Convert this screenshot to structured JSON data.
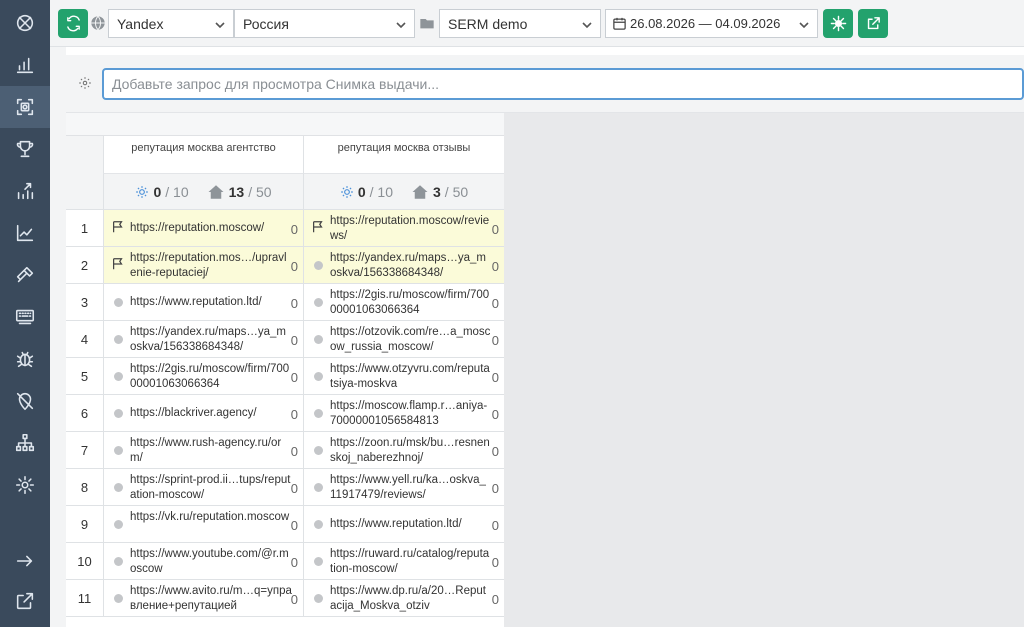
{
  "sidebar": {
    "items": [
      {
        "icon": "logo-icon"
      },
      {
        "icon": "bar-chart-icon"
      },
      {
        "icon": "camera-scan-icon",
        "active": true
      },
      {
        "icon": "trophy-icon"
      },
      {
        "icon": "chart-up-icon"
      },
      {
        "icon": "line-chart-icon"
      },
      {
        "icon": "hammer-icon"
      },
      {
        "icon": "keyboard-icon"
      },
      {
        "icon": "bug-icon"
      },
      {
        "icon": "location-off-icon"
      },
      {
        "icon": "sitemap-icon"
      },
      {
        "icon": "settings-icon"
      },
      {
        "icon": "arrow-right-icon"
      },
      {
        "icon": "external-link-icon"
      }
    ]
  },
  "toolbar": {
    "search_engine": "Yandex",
    "region": "Россия",
    "project": "SERM demo",
    "date_range": "26.08.2026 — 04.09.2026",
    "accent_color": "#23a26d"
  },
  "query": {
    "placeholder": "Добавьте запрос для просмотра Снимка выдачи..."
  },
  "columns": [
    {
      "title": "репутация москва агентство",
      "stat_sun": "0",
      "stat_sun_total": "/ 10",
      "stat_home": "13",
      "stat_home_total": "/ 50"
    },
    {
      "title": "репутация москва отзывы",
      "stat_sun": "0",
      "stat_sun_total": "/ 10",
      "stat_home": "3",
      "stat_home_total": "/ 50"
    }
  ],
  "rows": [
    {
      "n": "1",
      "highlight": true,
      "a": {
        "url": "https://reputation.moscow/",
        "mark": "flag",
        "score": "0"
      },
      "b": {
        "url": "https://reputation.moscow/reviews/",
        "mark": "flag",
        "score": "0"
      }
    },
    {
      "n": "2",
      "highlight": true,
      "a": {
        "url": "https://reputation.mos…/upravlenie-reputaciej/",
        "mark": "flag",
        "score": "0"
      },
      "b": {
        "url": "https://yandex.ru/maps…ya_moskva/156338684348/",
        "mark": "dot",
        "score": "0"
      }
    },
    {
      "n": "3",
      "highlight": false,
      "a": {
        "url": "https://www.reputation.ltd/",
        "mark": "dot",
        "score": "0"
      },
      "b": {
        "url": "https://2gis.ru/moscow/firm/70000001063066364",
        "mark": "dot",
        "score": "0"
      }
    },
    {
      "n": "4",
      "highlight": false,
      "a": {
        "url": "https://yandex.ru/maps…ya_moskva/156338684348/",
        "mark": "dot",
        "score": "0"
      },
      "b": {
        "url": "https://otzovik.com/re…a_moscow_russia_moscow/",
        "mark": "dot",
        "score": "0"
      }
    },
    {
      "n": "5",
      "highlight": false,
      "a": {
        "url": "https://2gis.ru/moscow/firm/70000001063066364",
        "mark": "dot",
        "score": "0"
      },
      "b": {
        "url": "https://www.otzyvru.com/reputatsiya-moskva",
        "mark": "dot",
        "score": "0"
      }
    },
    {
      "n": "6",
      "highlight": false,
      "a": {
        "url": "https://blackriver.agency/",
        "mark": "dot",
        "score": "0"
      },
      "b": {
        "url": "https://moscow.flamp.r…aniya-70000001056584813",
        "mark": "dot",
        "score": "0"
      }
    },
    {
      "n": "7",
      "highlight": false,
      "a": {
        "url": "https://www.rush-agency.ru/orm/",
        "mark": "dot",
        "score": "0"
      },
      "b": {
        "url": "https://zoon.ru/msk/bu…resnenskoj_naberezhnoj/",
        "mark": "dot",
        "score": "0"
      }
    },
    {
      "n": "8",
      "highlight": false,
      "a": {
        "url": "https://sprint-prod.ii…tups/reputation-moscow/",
        "mark": "dot",
        "score": "0"
      },
      "b": {
        "url": "https://www.yell.ru/ka…oskva_11917479/reviews/",
        "mark": "dot",
        "score": "0"
      }
    },
    {
      "n": "9",
      "highlight": false,
      "a": {
        "url": "https://vk.ru/reputation.moscow",
        "mark": "dot",
        "score": "0"
      },
      "b": {
        "url": "https://www.reputation.ltd/",
        "mark": "dot",
        "score": "0"
      }
    },
    {
      "n": "10",
      "highlight": false,
      "a": {
        "url": "https://www.youtube.com/@r.moscow",
        "mark": "dot",
        "score": "0"
      },
      "b": {
        "url": "https://ruward.ru/catalog/reputation-moscow/",
        "mark": "dot",
        "score": "0"
      }
    },
    {
      "n": "11",
      "highlight": false,
      "a": {
        "url": "https://www.avito.ru/m…q=управление+репутацией",
        "mark": "dot",
        "score": "0"
      },
      "b": {
        "url": "https://www.dp.ru/a/20…Reputacija_Moskva_otziv",
        "mark": "dot",
        "score": "0"
      }
    }
  ]
}
